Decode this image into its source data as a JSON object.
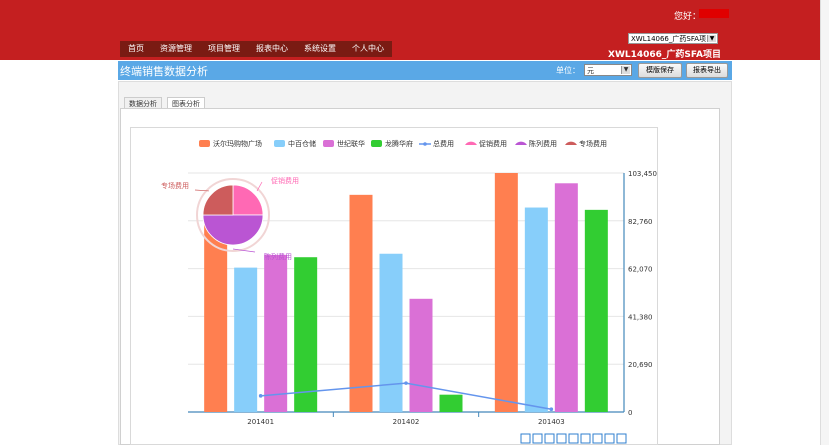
{
  "header": {
    "greeting": "您好：",
    "nav": [
      "首页",
      "资源管理",
      "项目管理",
      "报表中心",
      "系统设置",
      "个人中心"
    ],
    "project_select": "XWL14066_广药SFA项",
    "project_name": "XWL14066_广药SFA项目"
  },
  "toolbar": {
    "title": "终端销售数据分析",
    "unit_label": "单位：",
    "unit_value": "元",
    "save_template": "模版保存",
    "export_report": "报表导出"
  },
  "tabs": [
    {
      "label": "数据分析",
      "active": false
    },
    {
      "label": "图表分析",
      "active": true
    }
  ],
  "chart_data": {
    "type": "bar",
    "categories": [
      "201401",
      "201402",
      "201403"
    ],
    "series": [
      {
        "name": "沃尔玛购物广场",
        "type": "bar",
        "color": "#ff7f50",
        "values": [
          82000,
          94000,
          103450
        ]
      },
      {
        "name": "中百仓储",
        "type": "bar",
        "color": "#87cefa",
        "values": [
          62500,
          68500,
          88500
        ]
      },
      {
        "name": "世纪联华",
        "type": "bar",
        "color": "#da70d6",
        "values": [
          68000,
          49000,
          99000
        ]
      },
      {
        "name": "龙腾华府",
        "type": "bar",
        "color": "#32cd32",
        "values": [
          67000,
          7500,
          87500
        ]
      },
      {
        "name": "总费用",
        "type": "line",
        "color": "#6495ed",
        "values": [
          7000,
          12500,
          1200
        ]
      }
    ],
    "pie": {
      "slices": [
        {
          "name": "促销费用",
          "color": "#ff69b4",
          "value": 25
        },
        {
          "name": "陈列费用",
          "color": "#ba55d3",
          "value": 50
        },
        {
          "name": "专场费用",
          "color": "#cd5c5c",
          "value": 25
        }
      ]
    },
    "yaxis_ticks": [
      "103,450",
      "82,760",
      "62,070",
      "41,380",
      "20,690",
      "0"
    ],
    "ylim": [
      0,
      103450
    ],
    "legend_position": "top",
    "grid": true
  }
}
